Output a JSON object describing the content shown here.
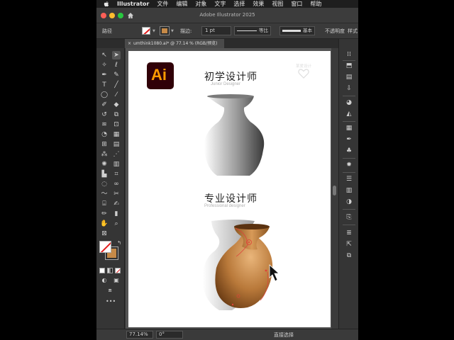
{
  "menubar": {
    "app_name": "Illustrator",
    "items": [
      "文件",
      "编辑",
      "对象",
      "文字",
      "选择",
      "效果",
      "视图",
      "窗口",
      "帮助"
    ]
  },
  "window": {
    "title": "Adobe Illustrator 2025"
  },
  "control_bar": {
    "object_type": "路径",
    "stroke_label": "描边:",
    "stroke_width": "1 pt",
    "profile": "等比",
    "brush": "基本",
    "opacity_label": "不透明度",
    "style_label": "样式",
    "fill_color": "#ffffff",
    "stroke_color": "#c68a48"
  },
  "document_tab": {
    "name": "umthink1080.ai* @ 77.14 % (RGB/预览)"
  },
  "artboard": {
    "logo_text": "Ai",
    "watermark_text": "某爱设计",
    "junior_title": "初学设计师",
    "junior_subtitle": "Junior Designer",
    "pro_title": "专业设计师",
    "pro_subtitle": "Professional designer",
    "vase_color": "#c68a48"
  },
  "status_bar": {
    "zoom": "77.14%",
    "rotation": "0°",
    "current_tool": "直接选择"
  }
}
